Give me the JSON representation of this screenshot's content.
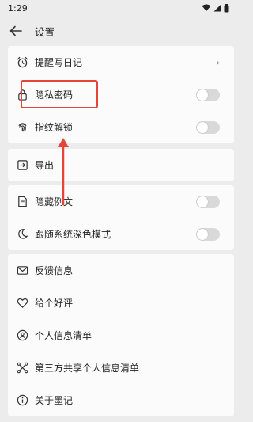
{
  "status": {
    "time": "1:29"
  },
  "header": {
    "title": "设置"
  },
  "groups": [
    {
      "items": [
        {
          "label": "提醒写日记",
          "icon": "alarm-clock-icon",
          "control": "chevron"
        },
        {
          "label": "隐私密码",
          "icon": "lock-icon",
          "control": "toggle",
          "on": false
        },
        {
          "label": "指纹解锁",
          "icon": "fingerprint-icon",
          "control": "toggle",
          "on": false
        }
      ]
    },
    {
      "items": [
        {
          "label": "导出",
          "icon": "export-icon",
          "control": "none"
        }
      ]
    },
    {
      "items": [
        {
          "label": "隐藏例文",
          "icon": "document-icon",
          "control": "toggle",
          "on": false
        },
        {
          "label": "跟随系统深色模式",
          "icon": "moon-icon",
          "control": "toggle",
          "on": false
        }
      ]
    },
    {
      "items": [
        {
          "label": "反馈信息",
          "icon": "mail-icon",
          "control": "none"
        },
        {
          "label": "给个好评",
          "icon": "heart-icon",
          "control": "none"
        },
        {
          "label": "个人信息清单",
          "icon": "person-info-icon",
          "control": "none"
        },
        {
          "label": "第三方共享个人信息清单",
          "icon": "share-icon",
          "control": "none"
        },
        {
          "label": "关于墨记",
          "icon": "info-icon",
          "control": "none"
        }
      ]
    }
  ],
  "annotation": {
    "highlight_color": "#e4443a"
  }
}
